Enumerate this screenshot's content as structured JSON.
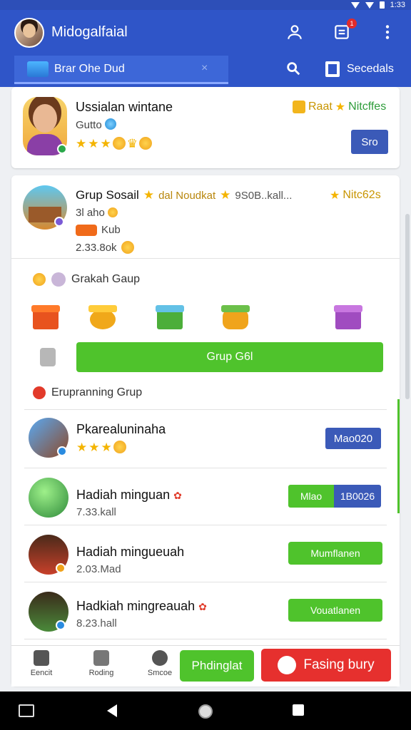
{
  "status": {
    "time": "1:33"
  },
  "header": {
    "title": "Midogalfaial",
    "notif_count": "1"
  },
  "tabs": {
    "active_label": "Brar Ohe Dud",
    "close": "×",
    "secondary_label": "Secedals"
  },
  "profile_card": {
    "name": "Ussialan wintane",
    "subtitle": "Gutto",
    "right_tag": "Raat",
    "right_tag_2": "Nitcffes",
    "button": "Sro"
  },
  "group_card": {
    "name": "Grup Sosail",
    "tag1": "dal Noudkat",
    "tag2": "9S0B..kall...",
    "right_tag": "Nitc62s",
    "sub1": "3l aho",
    "sub2": "Kub",
    "sub3": "2.33.8ok",
    "section1": "Grakah Gaup",
    "cta": "Grup G6l",
    "section2": "Erupranning Grup"
  },
  "rows": [
    {
      "name": "Pkarealuninaha",
      "sub": "",
      "button": "Mao020",
      "button_type": "blue"
    },
    {
      "name": "Hadiah minguan",
      "sub": "7.33.kall",
      "button_left": "Mlao",
      "button_right": "1B0026",
      "button_type": "split"
    },
    {
      "name": "Hadiah mingueuah",
      "sub": "2.03.Mad",
      "button": "Mumflanen",
      "button_type": "green"
    },
    {
      "name": "Hadkiah mingreauah",
      "sub": "8.23.hall",
      "button": "Vouatlanen",
      "button_type": "green"
    }
  ],
  "bottom_bar": {
    "nav1": "Eencit",
    "nav2": "Roding",
    "nav3": "Smcoe",
    "primary": "Phdinglat",
    "danger": "Fasing bury"
  }
}
